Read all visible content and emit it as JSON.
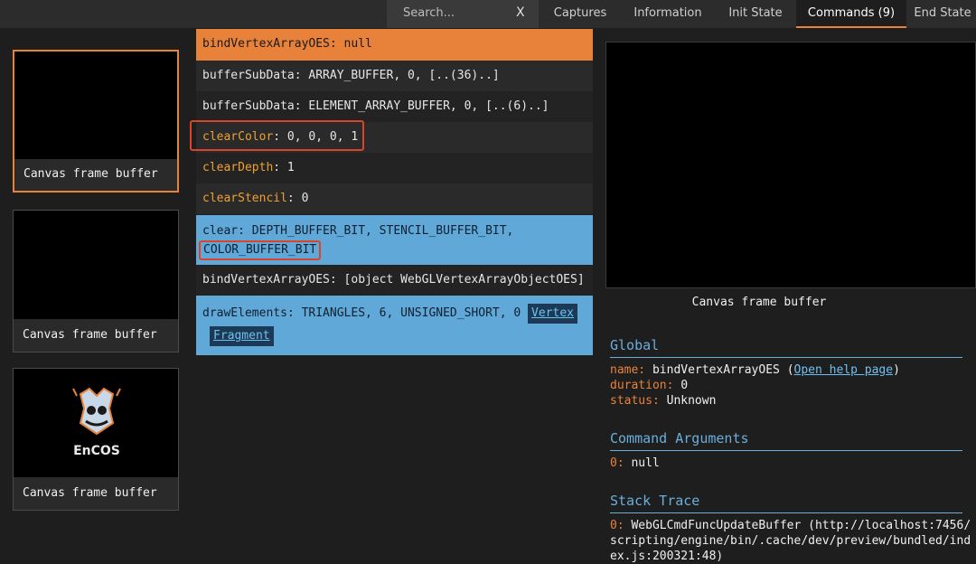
{
  "topbar": {
    "search_placeholder": "Search...",
    "clear_label": "X",
    "tabs": [
      {
        "label": "Captures"
      },
      {
        "label": "Information"
      },
      {
        "label": "Init State"
      },
      {
        "label": "Commands (9)",
        "active": true
      },
      {
        "label": "End State"
      }
    ]
  },
  "thumbnails": [
    {
      "caption": "Canvas frame buffer",
      "active": true
    },
    {
      "caption": "Canvas frame buffer"
    },
    {
      "caption": "Canvas frame buffer",
      "logo_text": "EnCOS"
    }
  ],
  "commands": [
    {
      "name": "bindVertexArrayOES",
      "args": ": null"
    },
    {
      "name": "bufferSubData",
      "args": ": ARRAY_BUFFER, 0, [..(36)..]"
    },
    {
      "name": "bufferSubData",
      "args": ": ELEMENT_ARRAY_BUFFER, 0, [..(6)..]"
    },
    {
      "name": "clearColor",
      "args": ": 0, 0, 0, 1"
    },
    {
      "name": "clearDepth",
      "args": ": 1"
    },
    {
      "name": "clearStencil",
      "args": ": 0"
    },
    {
      "name": "clear",
      "args": ": DEPTH_BUFFER_BIT, STENCIL_BUFFER_BIT,",
      "args2": "COLOR_BUFFER_BIT"
    },
    {
      "name": "bindVertexArrayOES",
      "args": ": [object WebGLVertexArrayObjectOES]"
    },
    {
      "name": "drawElements",
      "args": ": TRIANGLES, 6, UNSIGNED_SHORT, 0",
      "link1": "Vertex",
      "link2": "Fragment"
    }
  ],
  "preview": {
    "caption": "Canvas frame buffer"
  },
  "global": {
    "title": "Global",
    "name_key": "name:",
    "name_value": "bindVertexArrayOES",
    "help_open": "(",
    "help_link": "Open help page",
    "help_close": ")",
    "duration_key": "duration:",
    "duration_value": "0",
    "status_key": "status:",
    "status_value": "Unknown"
  },
  "arguments": {
    "title": "Command Arguments",
    "index": "0:",
    "value": "null"
  },
  "stack": {
    "title": "Stack Trace",
    "index": "0:",
    "line1": "WebGLCmdFuncUpdateBuffer (http://localhost:7456/",
    "line2": "scripting/engine/bin/.cache/dev/preview/bundled/ind",
    "line3": "ex.js:200321:48)"
  },
  "colors": {
    "accent": "#e8823a",
    "selected_row": "#e8823a",
    "draw_row": "#5fa8d8",
    "link": "#6aaedc",
    "highlight_box": "#d9452b"
  }
}
